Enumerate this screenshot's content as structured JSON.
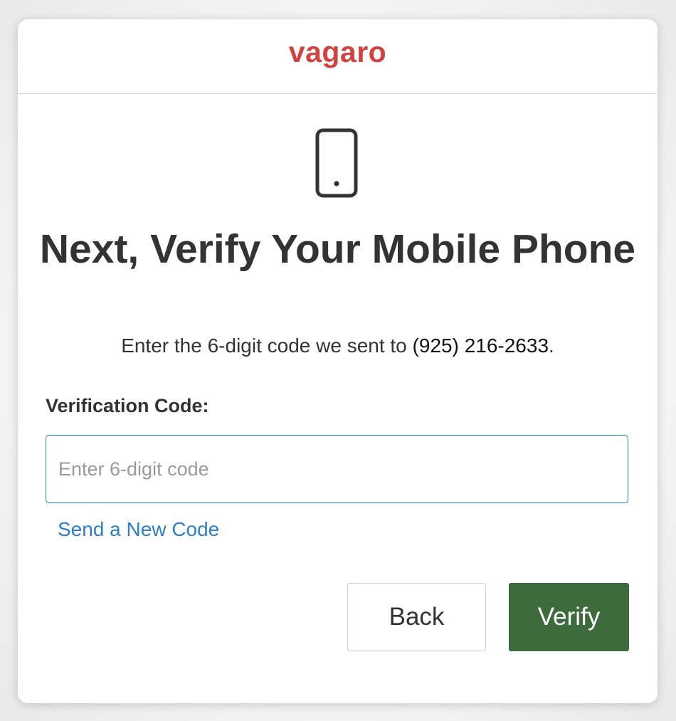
{
  "brand": {
    "logo_text": "vagaro",
    "accent_color": "#d2423f"
  },
  "verify": {
    "icon": "mobile-phone-icon",
    "title": "Next, Verify Your Mobile Phone",
    "instruction_prefix": "Enter the 6-digit code we sent to ",
    "phone_number": "(925) 216-2633",
    "instruction_suffix": ".",
    "field_label": "Verification Code:",
    "code_value": "",
    "code_placeholder": "Enter 6-digit code",
    "resend_label": "Send a New Code"
  },
  "actions": {
    "back_label": "Back",
    "verify_label": "Verify",
    "verify_color": "#3d6b3c",
    "link_color": "#2d7fc7"
  }
}
